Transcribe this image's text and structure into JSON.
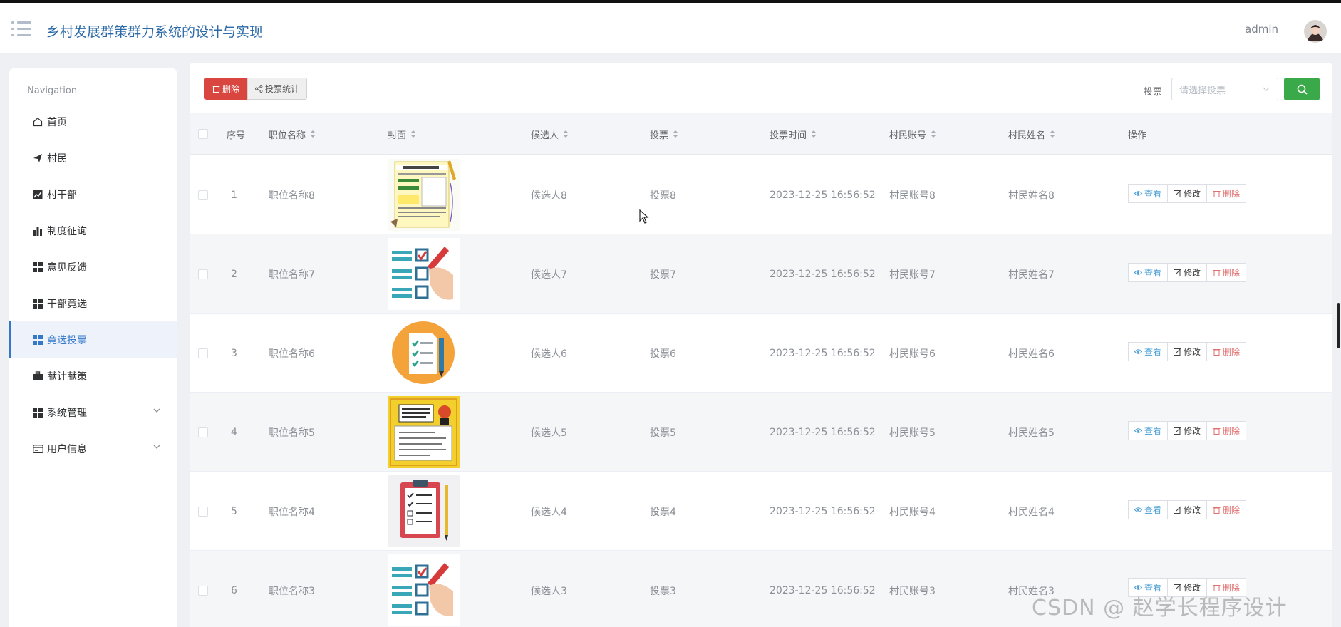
{
  "header": {
    "title": "乡村发展群策群力系统的设计与实现",
    "user": "admin"
  },
  "sidebar": {
    "caption": "Navigation",
    "items": [
      {
        "label": "首页",
        "icon": "home-icon"
      },
      {
        "label": "村民",
        "icon": "send-icon"
      },
      {
        "label": "村干部",
        "icon": "line-chart-icon"
      },
      {
        "label": "制度征询",
        "icon": "bar-chart-icon"
      },
      {
        "label": "意见反馈",
        "icon": "grid-icon"
      },
      {
        "label": "干部竟选",
        "icon": "grid-icon"
      },
      {
        "label": "竟选投票",
        "icon": "grid-icon",
        "active": true
      },
      {
        "label": "献计献策",
        "icon": "briefcase-icon"
      },
      {
        "label": "系统管理",
        "icon": "grid-icon",
        "expandable": true
      },
      {
        "label": "用户信息",
        "icon": "card-icon",
        "expandable": true
      }
    ]
  },
  "toolbar": {
    "delete_label": "删除",
    "stats_label": "投票统计",
    "filter_label": "投票",
    "filter_placeholder": "请选择投票"
  },
  "table": {
    "columns": [
      "序号",
      "职位名称",
      "封面",
      "候选人",
      "投票",
      "投票时间",
      "村民账号",
      "村民姓名",
      "操作"
    ],
    "actions": {
      "view": "查看",
      "edit": "修改",
      "delete": "删除"
    },
    "rows": [
      {
        "index": "1",
        "position": "职位名称8",
        "cover": "survey-poster",
        "candidate": "候选人8",
        "vote": "投票8",
        "time": "2023-12-25 16:56:52",
        "account": "村民账号8",
        "name": "村民姓名8"
      },
      {
        "index": "2",
        "position": "职位名称7",
        "cover": "checklist-hand",
        "candidate": "候选人7",
        "vote": "投票7",
        "time": "2023-12-25 16:56:52",
        "account": "村民账号7",
        "name": "村民姓名7"
      },
      {
        "index": "3",
        "position": "职位名称6",
        "cover": "orange-clipboard",
        "candidate": "候选人6",
        "vote": "投票6",
        "time": "2023-12-25 16:56:52",
        "account": "村民账号6",
        "name": "村民姓名6"
      },
      {
        "index": "4",
        "position": "职位名称5",
        "cover": "yellow-notice",
        "candidate": "候选人5",
        "vote": "投票5",
        "time": "2023-12-25 16:56:52",
        "account": "村民账号5",
        "name": "村民姓名5"
      },
      {
        "index": "5",
        "position": "职位名称4",
        "cover": "red-clipboard",
        "candidate": "候选人4",
        "vote": "投票4",
        "time": "2023-12-25 16:56:52",
        "account": "村民账号4",
        "name": "村民姓名4"
      },
      {
        "index": "6",
        "position": "职位名称3",
        "cover": "checklist-hand",
        "candidate": "候选人3",
        "vote": "投票3",
        "time": "2023-12-25 16:56:52",
        "account": "村民账号3",
        "name": "村民姓名3"
      }
    ]
  },
  "watermark": "CSDN @ 赵学长程序设计"
}
